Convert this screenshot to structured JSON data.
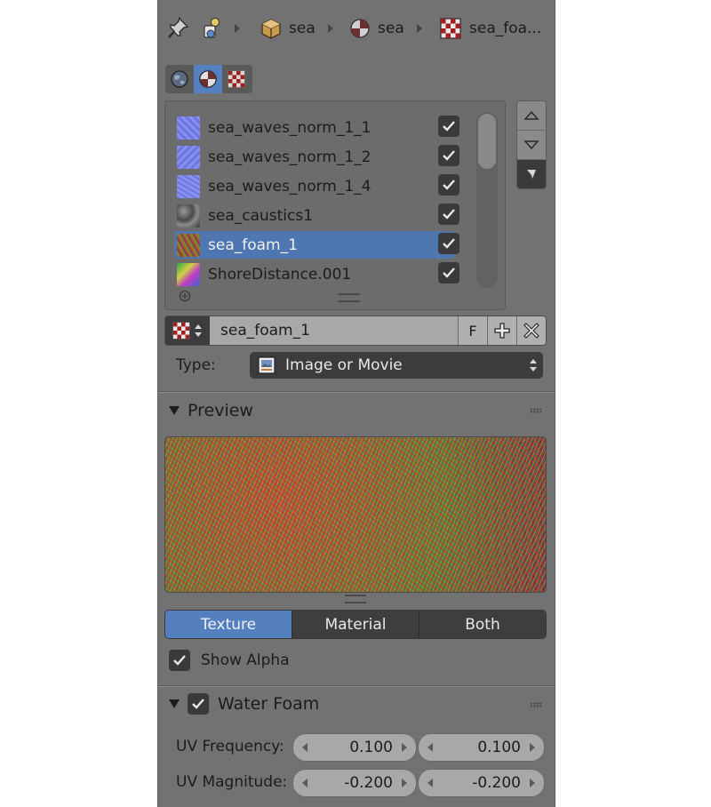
{
  "breadcrumb": {
    "items": [
      {
        "label": "sea",
        "icon": "cube-icon"
      },
      {
        "label": "sea",
        "icon": "material-sphere-icon"
      },
      {
        "label": "sea_foa...",
        "icon": "checker-texture-icon"
      }
    ]
  },
  "context_tabs": [
    {
      "icon": "world-icon",
      "active": false
    },
    {
      "icon": "material-sphere-icon",
      "active": true
    },
    {
      "icon": "checker-texture-icon",
      "active": false
    }
  ],
  "texture_slots": [
    {
      "label": "sea_waves_norm_1_1",
      "enabled": true,
      "selected": false
    },
    {
      "label": "sea_waves_norm_1_2",
      "enabled": true,
      "selected": false
    },
    {
      "label": "sea_waves_norm_1_4",
      "enabled": true,
      "selected": false
    },
    {
      "label": "sea_caustics1",
      "enabled": true,
      "selected": false
    },
    {
      "label": "sea_foam_1",
      "enabled": true,
      "selected": true
    },
    {
      "label": "ShoreDistance.001",
      "enabled": true,
      "selected": false
    }
  ],
  "texture_id": {
    "name": "sea_foam_1",
    "fake_user_label": "F"
  },
  "type": {
    "label": "Type:",
    "value": "Image or Movie"
  },
  "preview": {
    "header": "Preview",
    "modes": [
      {
        "label": "Texture",
        "active": true
      },
      {
        "label": "Material",
        "active": false
      },
      {
        "label": "Both",
        "active": false
      }
    ],
    "show_alpha_label": "Show Alpha",
    "show_alpha_checked": true
  },
  "water_foam": {
    "header": "Water Foam",
    "enabled": true,
    "uv_frequency_label": "UV Frequency:",
    "uv_frequency": [
      "0.100",
      "0.100"
    ],
    "uv_magnitude_label": "UV Magnitude:",
    "uv_magnitude": [
      "-0.200",
      "-0.200"
    ]
  },
  "colors": {
    "panel_bg": "#727272",
    "accent": "#5580c0",
    "selected_row": "#4e76b0"
  }
}
